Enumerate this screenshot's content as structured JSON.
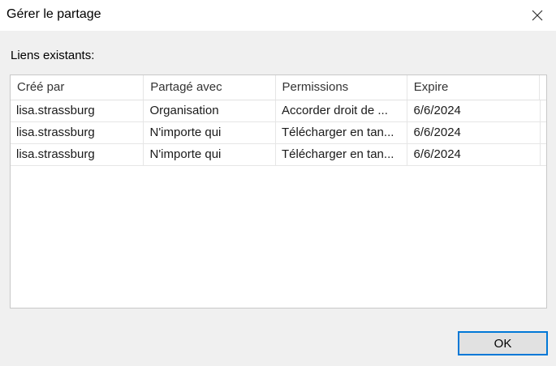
{
  "window": {
    "title": "Gérer le partage",
    "close_icon": "close-icon"
  },
  "section_label": "Liens existants:",
  "table": {
    "columns": [
      "Créé par",
      "Partagé avec",
      "Permissions",
      "Expire"
    ],
    "rows": [
      [
        "lisa.strassburg",
        "Organisation",
        "Accorder droit de ...",
        "6/6/2024"
      ],
      [
        "lisa.strassburg",
        "N'importe qui",
        "Télécharger en tan...",
        "6/6/2024"
      ],
      [
        "lisa.strassburg",
        "N'importe qui",
        "Télécharger en tan...",
        "6/6/2024"
      ]
    ]
  },
  "buttons": {
    "ok_label": "OK"
  },
  "colors": {
    "accent": "#0078d7",
    "dialog_bg": "#f0f0f0"
  }
}
